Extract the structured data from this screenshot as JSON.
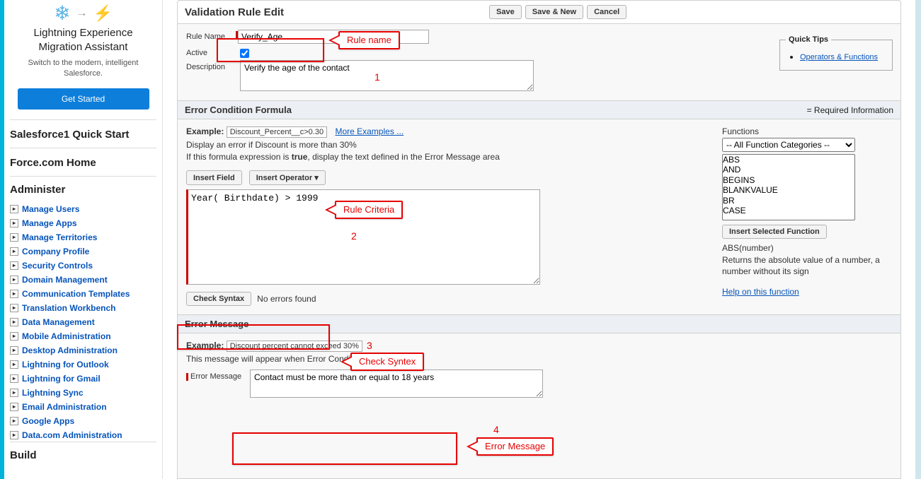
{
  "migration": {
    "title": "Lightning Experience Migration Assistant",
    "subtitle": "Switch to the modern, intelligent Salesforce.",
    "button": "Get Started"
  },
  "sidebar_quickstart": "Salesforce1 Quick Start",
  "sidebar_home": "Force.com Home",
  "sidebar_admin_title": "Administer",
  "sidebar_build_title": "Build",
  "admin_items": [
    "Manage Users",
    "Manage Apps",
    "Manage Territories",
    "Company Profile",
    "Security Controls",
    "Domain Management",
    "Communication Templates",
    "Translation Workbench",
    "Data Management",
    "Mobile Administration",
    "Desktop Administration",
    "Lightning for Outlook",
    "Lightning for Gmail",
    "Lightning Sync",
    "Email Administration",
    "Google Apps",
    "Data.com Administration"
  ],
  "header": {
    "title": "Validation Rule Edit",
    "save": "Save",
    "save_new": "Save & New",
    "cancel": "Cancel"
  },
  "form": {
    "rule_name_label": "Rule Name",
    "rule_name_value": "Verify_Age",
    "active_label": "Active",
    "active_checked": true,
    "description_label": "Description",
    "description_value": "Verify the age of the contact"
  },
  "quicktips": {
    "title": "Quick Tips",
    "link": "Operators & Functions"
  },
  "required_text": "= Required Information",
  "section_formula": "Error Condition Formula",
  "example_label": "Example:",
  "formula_example_value": "Discount_Percent__c>0.30",
  "more_examples": "More Examples ...",
  "formula_hint1": "Display an error if Discount is more than 30%",
  "formula_hint2_pre": "If this formula expression is ",
  "formula_hint2_bold": "true",
  "formula_hint2_post": ", display the text defined in the Error Message area",
  "insert_field": "Insert Field",
  "insert_operator": "Insert Operator  ▾",
  "formula_value": "Year( Birthdate) > 1999",
  "check_syntax": "Check Syntax",
  "syntax_result": "No errors found",
  "functions": {
    "label": "Functions",
    "category": "-- All Function Categories --",
    "list": [
      "ABS",
      "AND",
      "BEGINS",
      "BLANKVALUE",
      "BR",
      "CASE"
    ],
    "insert_btn": "Insert Selected Function",
    "signature": "ABS(number)",
    "description": "Returns the absolute value of a number, a number without its sign",
    "help": "Help on this function"
  },
  "section_errmsg": "Error Message",
  "errmsg_example_value": "Discount percent cannot exceed 30%",
  "errmsg_hint_pre": "This message will appear when Error Condition formula is ",
  "errmsg_hint_bold": "true",
  "errmsg_label": "Error Message",
  "errmsg_value": "Contact must be more than or equal to 18 years",
  "annotations": {
    "rule_name": "Rule name",
    "rule_criteria": "Rule Criteria",
    "check_syntax": "Check Syntex",
    "error_message": "Error Message",
    "n1": "1",
    "n2": "2",
    "n3": "3",
    "n4": "4"
  }
}
